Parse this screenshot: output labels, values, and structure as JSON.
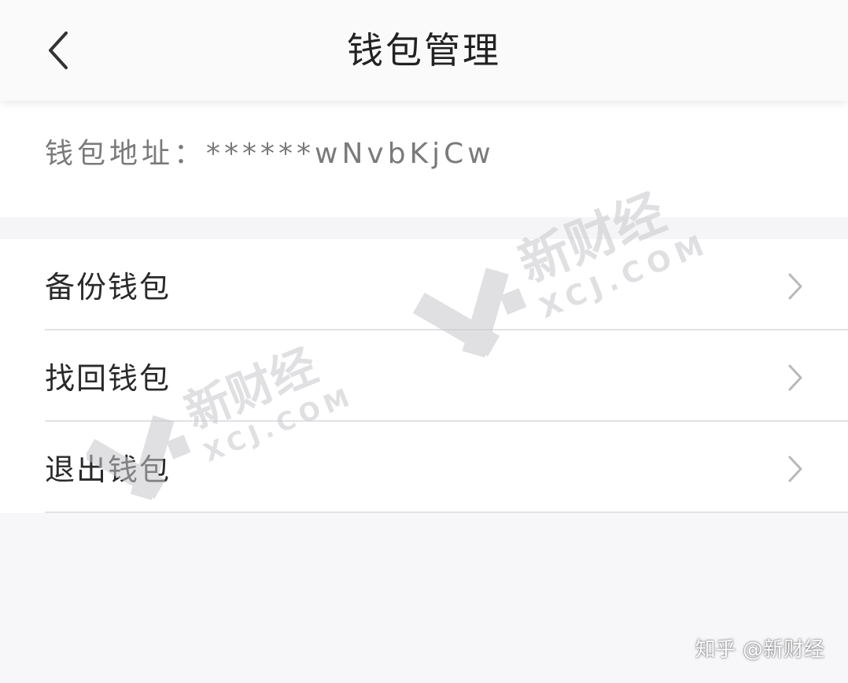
{
  "header": {
    "title": "钱包管理",
    "back_icon": "chevron-left-icon"
  },
  "wallet": {
    "address_label": "钱包地址：",
    "address_value": "******wNvbKjCw"
  },
  "menu": {
    "items": [
      {
        "label": "备份钱包",
        "icon": "chevron-right-icon"
      },
      {
        "label": "找回钱包",
        "icon": "chevron-right-icon"
      },
      {
        "label": "退出钱包",
        "icon": "chevron-right-icon"
      }
    ]
  },
  "watermark": {
    "brand": "新财经",
    "domain": "XCJ.COM",
    "attribution": "知乎 @新财经"
  },
  "colors": {
    "title": "#222222",
    "address_text": "#7a7a7a",
    "item_text": "#2a2a2a",
    "chevron": "#b8b8bc",
    "divider": "#e2e2e6",
    "background": "#f7f7fa",
    "watermark": "#c8c8cc"
  }
}
